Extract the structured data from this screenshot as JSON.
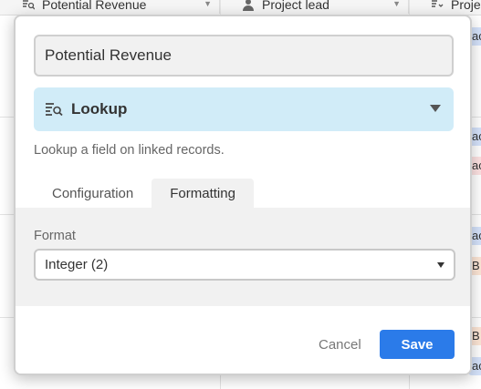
{
  "background_grid": {
    "columns": [
      {
        "label": "Potential Revenue",
        "icon": "lookup-icon"
      },
      {
        "label": "Project lead",
        "icon": "user-icon"
      },
      {
        "label": "Project",
        "icon": "lookup-icon"
      }
    ],
    "chips": [
      "ac",
      "ac",
      "ac",
      "ac",
      "B",
      "B",
      "ac"
    ]
  },
  "dialog": {
    "field_name": "Potential Revenue",
    "field_type": {
      "label": "Lookup",
      "icon": "lookup-icon"
    },
    "description": "Lookup a field on linked records.",
    "tabs": [
      {
        "label": "Configuration",
        "active": false
      },
      {
        "label": "Formatting",
        "active": true
      }
    ],
    "format": {
      "label": "Format",
      "value": "Integer (2)"
    },
    "cancel_label": "Cancel",
    "save_label": "Save"
  },
  "colors": {
    "type_background": "#d1ecf8",
    "save_button": "#2b7be9",
    "panel_background": "#f1f1f1"
  }
}
